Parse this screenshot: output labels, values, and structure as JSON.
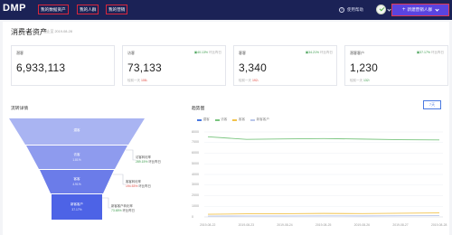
{
  "header": {
    "logo": "DMP",
    "nav": [
      "我的数据资产",
      "我的人群",
      "我的营销"
    ],
    "help_label": "使用帮助",
    "create_button": "新建营销人群",
    "plus_icon": "+"
  },
  "page": {
    "title": "消费者资产",
    "as_of": "截止至 2019-08-28"
  },
  "cards": [
    {
      "label": "潜客",
      "value": "6,933,113",
      "growth": "",
      "compare": "",
      "compare_num": ""
    },
    {
      "label": "访客",
      "value": "73,133",
      "growth": "40.13%",
      "growth_suffix": "环比昨日",
      "compare": "较前一天",
      "compare_num": "108"
    },
    {
      "label": "客客",
      "value": "3,340",
      "growth": "34.21%",
      "growth_suffix": "环比昨日",
      "compare": "较前一天",
      "compare_num": "192"
    },
    {
      "label": "潜客客户",
      "value": "1,230",
      "growth": "37.17%",
      "growth_suffix": "环比昨日",
      "compare": "较前一天",
      "compare_num": "132"
    }
  ],
  "funnel": {
    "title": "流转详情",
    "stages": [
      {
        "name": "潜客",
        "pct": ""
      },
      {
        "name": "访客",
        "pct": "1.81%"
      },
      {
        "name": "客客",
        "pct": "4.91%"
      },
      {
        "name": "新客客户",
        "pct": "37.17%"
      }
    ],
    "conversions": [
      {
        "label": "访客转化率",
        "value": "289.15%",
        "suffix": "环比昨日",
        "positive": true
      },
      {
        "label": "客客转化率",
        "value": "194.53%",
        "suffix": "环比昨日",
        "positive": false
      },
      {
        "label": "新客客户转化率",
        "value": "73.65%",
        "suffix": "环比昨日",
        "positive": true
      }
    ]
  },
  "trend": {
    "title": "趋势图",
    "range_button": "7天",
    "legend": [
      {
        "name": "潜客",
        "color": "#4a79e0"
      },
      {
        "name": "访客",
        "color": "#7ac57f"
      },
      {
        "name": "客客",
        "color": "#f2c34b"
      },
      {
        "name": "新客客户",
        "color": "#b9c6ea"
      }
    ]
  },
  "chart_data": {
    "type": "line",
    "title": "",
    "xlabel": "",
    "ylabel": "",
    "x": [
      "2019-08-22",
      "2019-08-23",
      "2019-08-24",
      "2019-08-25",
      "2019-08-26",
      "2019-08-27",
      "2019-08-28"
    ],
    "ylim": [
      0,
      8000
    ],
    "yticks": [
      "8000",
      "7000",
      "6000",
      "5000",
      "4000",
      "3000",
      "2000",
      "1000",
      "0"
    ],
    "series": [
      {
        "name": "访客",
        "color": "#7ac57f",
        "values": [
          7550,
          7300,
          7350,
          7380,
          7330,
          7270,
          7250
        ]
      },
      {
        "name": "客客",
        "color": "#f2c34b",
        "values": [
          250,
          290,
          300,
          330,
          310,
          350,
          380
        ]
      },
      {
        "name": "新客客户",
        "color": "#b9c6ea",
        "values": [
          80,
          90,
          90,
          100,
          95,
          110,
          120
        ]
      }
    ]
  }
}
